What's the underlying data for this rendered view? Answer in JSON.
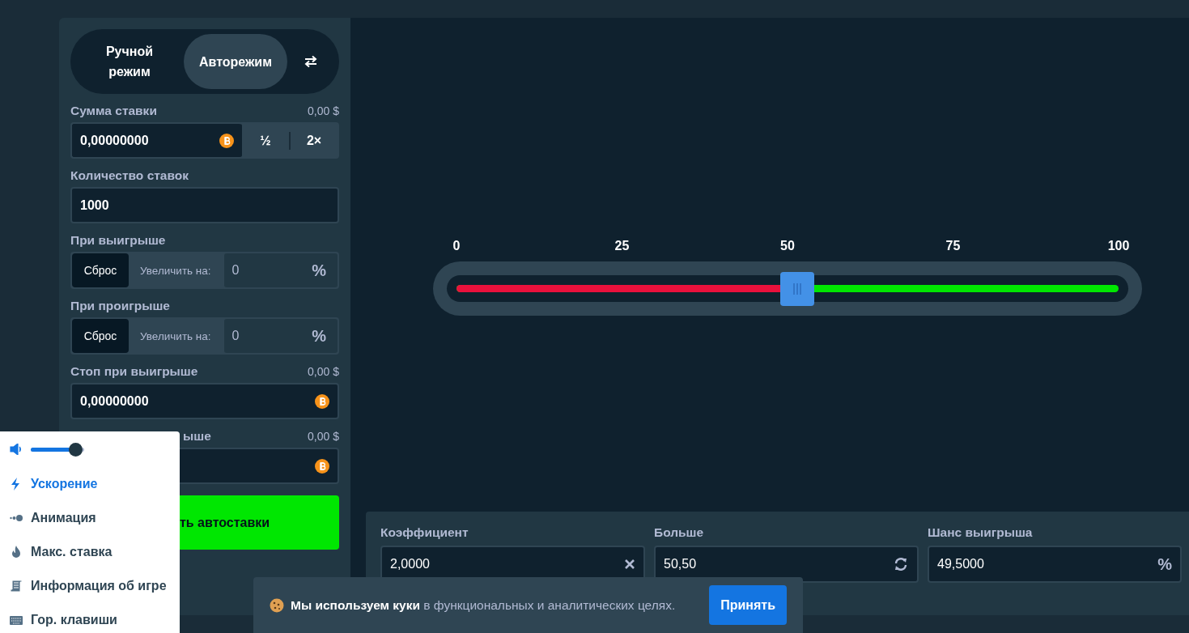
{
  "mode": {
    "tabs": [
      {
        "label": "Ручной режим",
        "selected": false
      },
      {
        "label": "Авторежим",
        "selected": true
      }
    ]
  },
  "bet": {
    "label": "Сумма ставки",
    "usd": "0,00 $",
    "value": "0,00000000",
    "half": "½",
    "double": "2×"
  },
  "count": {
    "label": "Количество ставок",
    "value": "1000"
  },
  "on_win": {
    "label": "При выигрыше",
    "reset": "Сброс",
    "increase_label": "Увеличить на:",
    "value": "0",
    "unit": "%"
  },
  "on_loss": {
    "label": "При проигрыше",
    "reset": "Сброс",
    "increase_label": "Увеличить на:",
    "value": "0",
    "unit": "%"
  },
  "stop_win": {
    "label": "Стоп при выигрыше",
    "usd": "0,00 $",
    "value": "0,00000000"
  },
  "stop_loss": {
    "label": "ыше",
    "usd": "0,00 $"
  },
  "start_button": "ть автоставки",
  "slider": {
    "ticks": [
      "0",
      "25",
      "50",
      "75",
      "100"
    ],
    "level": 0.5
  },
  "stats": [
    {
      "label": "Коэффициент",
      "value": "2,0000",
      "kind": "multiplier"
    },
    {
      "label": "Больше",
      "value": "50,50",
      "kind": "roll"
    },
    {
      "label": "Шанс выигрыша",
      "value": "49,5000",
      "kind": "chance",
      "unit": "%"
    }
  ],
  "menu": {
    "volume": {
      "level": 0.85
    },
    "items": [
      {
        "label": "Ускорение",
        "active": true
      },
      {
        "label": "Анимация",
        "active": false
      },
      {
        "label": "Макс. ставка",
        "active": false
      },
      {
        "label": "Информация об игре",
        "active": false
      },
      {
        "label": "Гор. клавиши",
        "active": false
      }
    ]
  },
  "cookie": {
    "text": "**Мы используем куки** в функциональных и аналитических целях.",
    "button": "Принять"
  }
}
